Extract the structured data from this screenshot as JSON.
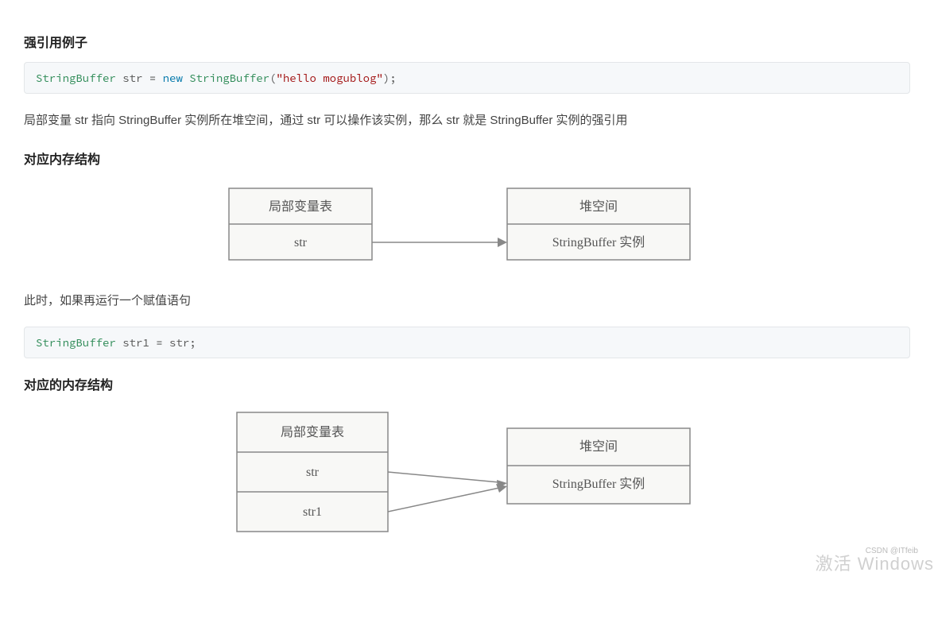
{
  "heading1": "强引用例子",
  "code1": {
    "cls1": "StringBuffer",
    "var": "str",
    "eq": "=",
    "kw": "new",
    "cls2": "StringBuffer",
    "paren_open": "(",
    "str": "\"hello mogublog\"",
    "paren_close": ");"
  },
  "para1": "局部变量 str 指向 StringBuffer 实例所在堆空间，通过 str 可以操作该实例，那么 str 就是 StringBuffer 实例的强引用",
  "heading2": "对应内存结构",
  "diagram1": {
    "left_header": "局部变量表",
    "left_cell": "str",
    "right_header": "堆空间",
    "right_cell": "StringBuffer 实例"
  },
  "para2": "此时，如果再运行一个赋值语句",
  "code2": {
    "cls": "StringBuffer",
    "var": "str1",
    "eq": "=",
    "rhs": "str;"
  },
  "heading3": "对应的内存结构",
  "diagram2": {
    "left_header": "局部变量表",
    "left_cell1": "str",
    "left_cell2": "str1",
    "right_header": "堆空间",
    "right_cell": "StringBuffer 实例"
  },
  "watermark": "CSDN @ITfeib",
  "activate": "激活 Windows"
}
